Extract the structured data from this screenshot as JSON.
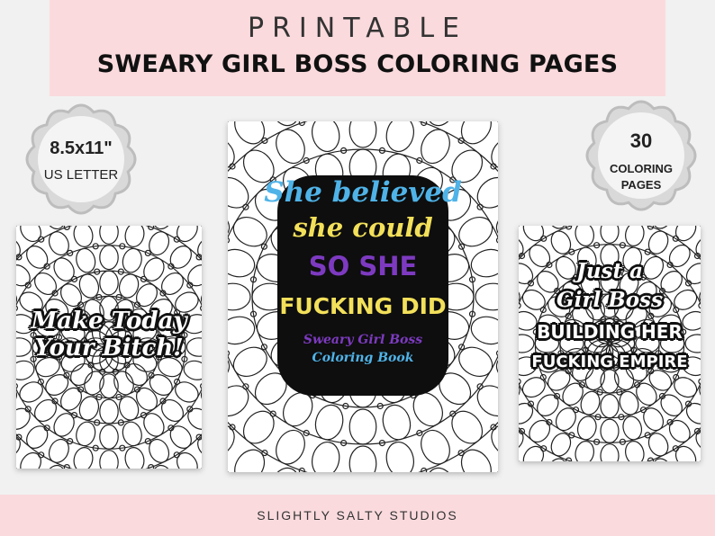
{
  "header": {
    "kicker": "PRINTABLE",
    "title": "SWEARY GIRL BOSS COLORING PAGES"
  },
  "badges": {
    "left": {
      "line1": "8.5x11\"",
      "line2": "US LETTER"
    },
    "right": {
      "line1": "30",
      "line2": "COLORING",
      "line3": "PAGES"
    }
  },
  "pages": {
    "left": {
      "line1": "Make Today",
      "line2": "Your Bitch!"
    },
    "center": {
      "line1": "She believed",
      "line2": "she could",
      "line3": "SO SHE",
      "line4": "FUCKING DID",
      "sub1": "Sweary Girl Boss",
      "sub2": "Coloring Book"
    },
    "right": {
      "line1": "Just a",
      "line2": "Girl Boss",
      "line3": "BUILDING HER",
      "line4": "FUCKING EMPIRE"
    }
  },
  "footer": {
    "brand": "SLIGHTLY SALTY STUDIOS"
  },
  "colors": {
    "banner": "#fadadd",
    "badge": "#d9d9d9",
    "pink": "#e8327c",
    "blue": "#4fb3e8",
    "purple": "#7d3ac1",
    "yellow": "#f3e05a"
  }
}
